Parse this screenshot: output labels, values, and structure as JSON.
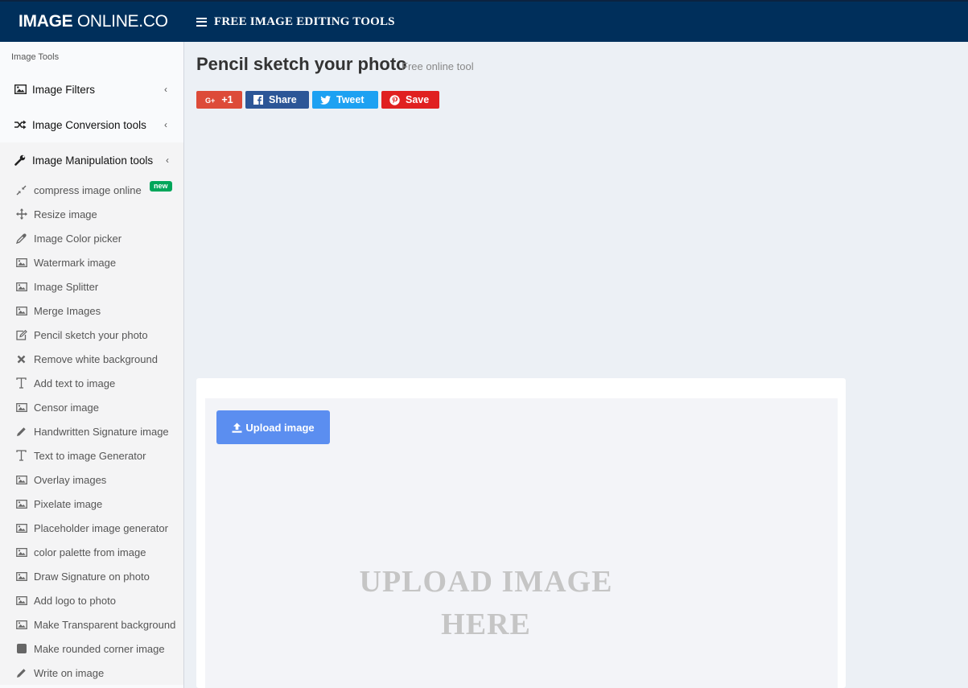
{
  "header": {
    "brand_bold": "IMAGE",
    "brand_light": " ONLINE.CO",
    "nav_title": "FREE IMAGE EDITING TOOLS"
  },
  "sidebar": {
    "header": "Image Tools",
    "menus": [
      {
        "label": "Image Filters",
        "icon": "picture-icon"
      },
      {
        "label": "Image Conversion tools",
        "icon": "random-icon"
      },
      {
        "label": "Image Manipulation tools",
        "icon": "wrench-icon"
      }
    ],
    "items": [
      {
        "label": "compress image online",
        "icon": "compress-icon",
        "badge": "new"
      },
      {
        "label": "Resize image",
        "icon": "arrows-move-icon"
      },
      {
        "label": "Image Color picker",
        "icon": "eyedropper-icon"
      },
      {
        "label": "Watermark image",
        "icon": "picture-icon"
      },
      {
        "label": "Image Splitter",
        "icon": "picture-icon"
      },
      {
        "label": "Merge Images",
        "icon": "picture-icon"
      },
      {
        "label": "Pencil sketch your photo",
        "icon": "edit-icon"
      },
      {
        "label": "Remove white background",
        "icon": "close-icon"
      },
      {
        "label": "Add text to image",
        "icon": "text-icon"
      },
      {
        "label": "Censor image",
        "icon": "picture-icon"
      },
      {
        "label": "Handwritten Signature image",
        "icon": "pencil-icon"
      },
      {
        "label": "Text to image Generator",
        "icon": "text-icon"
      },
      {
        "label": "Overlay images",
        "icon": "picture-icon"
      },
      {
        "label": "Pixelate image",
        "icon": "picture-icon"
      },
      {
        "label": "Placeholder image generator",
        "icon": "picture-icon"
      },
      {
        "label": "color palette from image",
        "icon": "picture-icon"
      },
      {
        "label": "Draw Signature on photo",
        "icon": "picture-icon"
      },
      {
        "label": "Add logo to photo",
        "icon": "picture-icon"
      },
      {
        "label": "Make Transparent background",
        "icon": "picture-icon"
      },
      {
        "label": "Make rounded corner image",
        "icon": "rounded-square-icon"
      },
      {
        "label": "Write on image",
        "icon": "pencil-icon"
      }
    ]
  },
  "main": {
    "title": "Pencil sketch your photo",
    "subtitle": "Free online tool",
    "share": {
      "gplus": "+1",
      "facebook": "Share",
      "twitter": "Tweet",
      "pinterest": "Save"
    },
    "upload_button": "Upload image",
    "dropzone_line1": "UPLOAD IMAGE",
    "dropzone_line2": "HERE"
  },
  "colors": {
    "topbar": "#002f5b",
    "gplus": "#dd4b39",
    "facebook": "#2c5697",
    "twitter": "#1da1f2",
    "pinterest": "#e02020",
    "upload": "#5b8ef0",
    "badge": "#00a65a"
  }
}
